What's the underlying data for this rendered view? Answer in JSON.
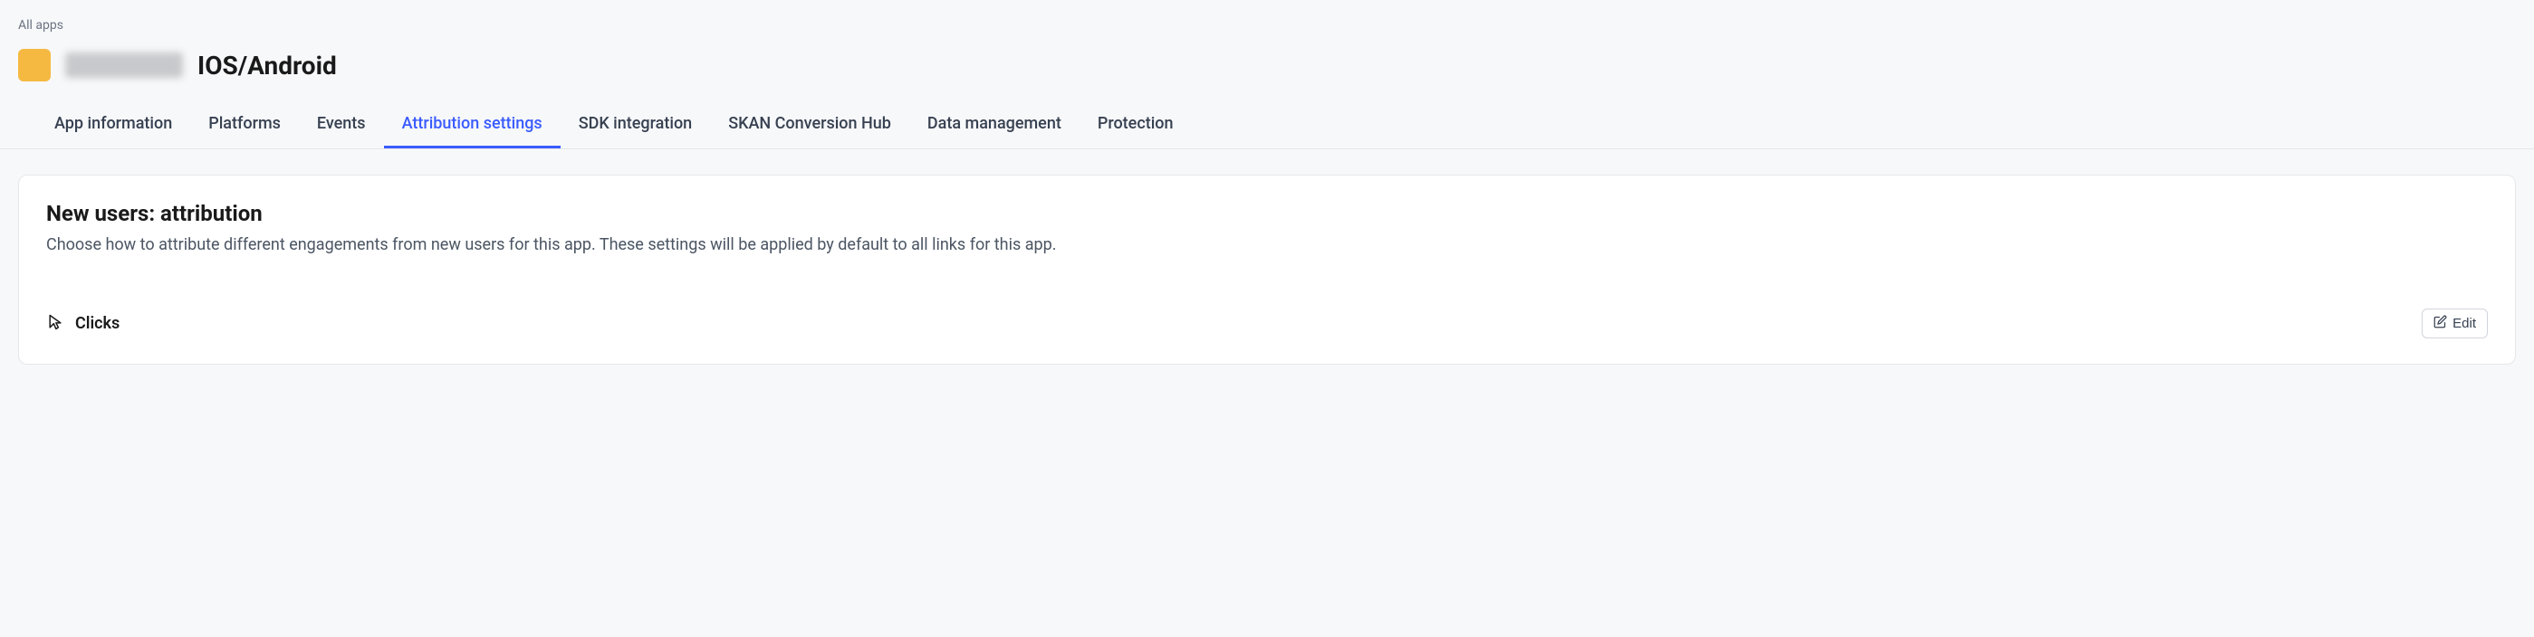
{
  "breadcrumb": "All apps",
  "app": {
    "title_suffix": "IOS/Android"
  },
  "tabs": {
    "items": [
      "App information",
      "Platforms",
      "Events",
      "Attribution settings",
      "SDK integration",
      "SKAN Conversion Hub",
      "Data management",
      "Protection"
    ],
    "active_index": 3
  },
  "section": {
    "title": "New users: attribution",
    "description": "Choose how to attribute different engagements from new users for this app. These settings will be applied by default to all links for this app."
  },
  "subsection": {
    "label": "Clicks",
    "edit_label": "Edit"
  }
}
